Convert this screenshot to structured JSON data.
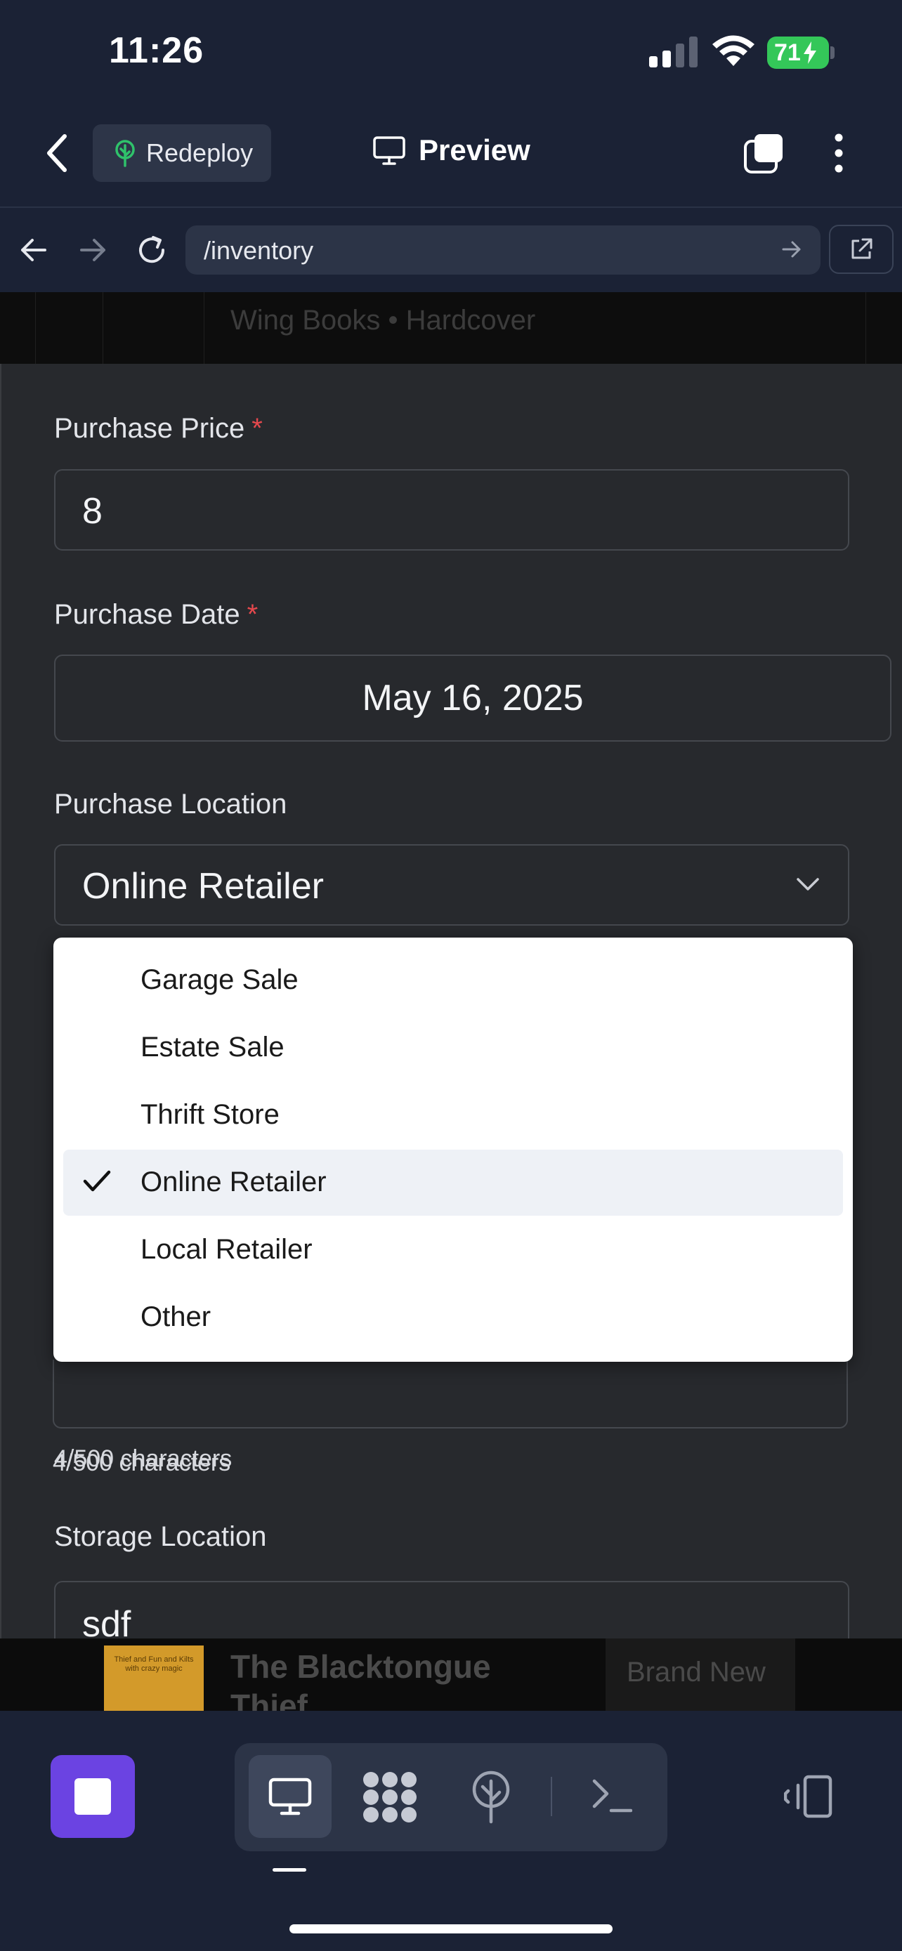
{
  "status_bar": {
    "time": "11:26",
    "battery": "71"
  },
  "app_header": {
    "redeploy_label": "Redeploy",
    "preview_label": "Preview"
  },
  "browser": {
    "url": "/inventory"
  },
  "background": {
    "top_row_subtitle": "Wing Books • Hardcover",
    "bottom_book_title": "The Blacktongue Thief",
    "bottom_book_cover_text": "Thief and Fun and Kilts with crazy magic",
    "bottom_brand": "Brand New"
  },
  "form": {
    "purchase_price": {
      "label": "Purchase Price",
      "required": "*",
      "value": "8"
    },
    "purchase_date": {
      "label": "Purchase Date",
      "required": "*",
      "value": "May 16, 2025"
    },
    "purchase_location": {
      "label": "Purchase Location",
      "value": "Online Retailer"
    },
    "notes_help": "4/500 characters",
    "storage_location": {
      "label": "Storage Location",
      "value": "sdf"
    }
  },
  "dropdown": {
    "options": [
      "Garage Sale",
      "Estate Sale",
      "Thrift Store",
      "Online Retailer",
      "Local Retailer",
      "Other"
    ],
    "selected": "Online Retailer"
  },
  "colors": {
    "accent_purple": "#6b43e2",
    "required_red": "#e5484d",
    "battery_green": "#34c759",
    "redeploy_icon_green": "#2fc26b"
  },
  "icons": [
    "back-chevron-icon",
    "tree-icon",
    "monitor-icon",
    "tabs-icon",
    "more-vertical-icon",
    "arrow-left-icon",
    "arrow-right-icon",
    "reload-icon",
    "go-arrow-icon",
    "external-link-icon",
    "chevron-down-icon",
    "check-icon",
    "stop-icon",
    "desktop-icon",
    "apps-grid-icon",
    "deploy-tree-icon",
    "terminal-icon",
    "device-rotate-icon"
  ]
}
